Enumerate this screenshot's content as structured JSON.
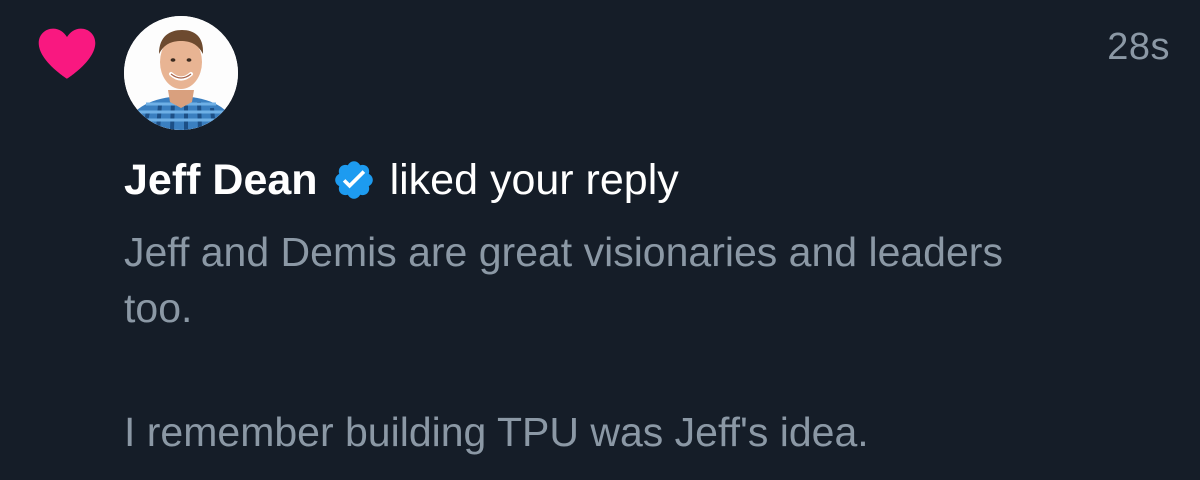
{
  "notification": {
    "type_icon": "heart-icon",
    "accent_color": "#f91880",
    "avatar_icon": "user-avatar",
    "timestamp": "28s",
    "author_name": "Jeff Dean",
    "verified_icon": "verified-badge-icon",
    "verified_color": "#1d9bf0",
    "action_text": "liked your reply",
    "reply_lines": [
      "Jeff and Demis are great visionaries and leaders",
      "too.",
      "I remember building TPU was Jeff's idea."
    ]
  }
}
